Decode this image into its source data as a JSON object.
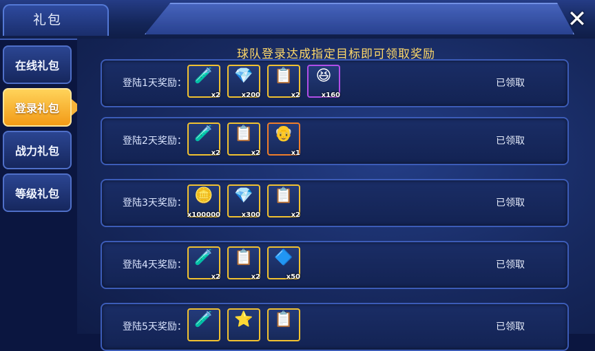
{
  "header": {
    "title": "礼包",
    "close_label": "✕"
  },
  "sidebar": {
    "tabs": [
      {
        "label": "在线礼包"
      },
      {
        "label": "登录礼包"
      },
      {
        "label": "战力礼包"
      },
      {
        "label": "等级礼包"
      }
    ],
    "active_index": 1
  },
  "main": {
    "subtitle": "球队登录达成指定目标即可领取奖励",
    "rows": [
      {
        "label": "登陆1天奖励：",
        "status": "已领取",
        "items": [
          {
            "icon": "green-potion-icon",
            "glyph": "🧪",
            "qty": "x2",
            "frame": "gold"
          },
          {
            "icon": "blue-diamond-icon",
            "glyph": "💎",
            "qty": "x200",
            "frame": "gold"
          },
          {
            "icon": "contract-clipboard-icon",
            "glyph": "📋",
            "qty": "x2",
            "frame": "gold"
          },
          {
            "icon": "player-portrait-icon",
            "glyph": "😆",
            "qty": "x160",
            "frame": "purple"
          }
        ]
      },
      {
        "label": "登陆2天奖励：",
        "status": "已领取",
        "items": [
          {
            "icon": "green-potion-icon",
            "glyph": "🧪",
            "qty": "x2",
            "frame": "gold"
          },
          {
            "icon": "contract-clipboard-icon",
            "glyph": "📋",
            "qty": "x2",
            "frame": "gold"
          },
          {
            "icon": "coach-portrait-icon",
            "glyph": "👴",
            "qty": "x1",
            "frame": "orange"
          }
        ]
      },
      {
        "label": "登陆3天奖励：",
        "status": "已领取",
        "items": [
          {
            "icon": "gold-coins-icon",
            "glyph": "🪙",
            "qty": "x100000",
            "frame": "gold"
          },
          {
            "icon": "blue-diamond-icon",
            "glyph": "💎",
            "qty": "x300",
            "frame": "gold"
          },
          {
            "icon": "contract-clipboard-icon",
            "glyph": "📋",
            "qty": "x2",
            "frame": "gold"
          }
        ]
      },
      {
        "label": "登陆4天奖励：",
        "status": "已领取",
        "items": [
          {
            "icon": "green-potion-icon",
            "glyph": "🧪",
            "qty": "x2",
            "frame": "gold"
          },
          {
            "icon": "contract-clipboard-icon",
            "glyph": "📋",
            "qty": "x2",
            "frame": "gold"
          },
          {
            "icon": "blue-gem-box-icon",
            "glyph": "🔷",
            "qty": "x50",
            "frame": "gold"
          }
        ]
      },
      {
        "label": "登陆5天奖励：",
        "status": "已领取",
        "items": [
          {
            "icon": "green-potion-icon",
            "glyph": "🧪",
            "qty": "",
            "frame": "gold"
          },
          {
            "icon": "gold-star-icon",
            "glyph": "⭐",
            "qty": "",
            "frame": "gold"
          },
          {
            "icon": "contract-clipboard-icon",
            "glyph": "📋",
            "qty": "",
            "frame": "gold"
          }
        ]
      }
    ]
  }
}
